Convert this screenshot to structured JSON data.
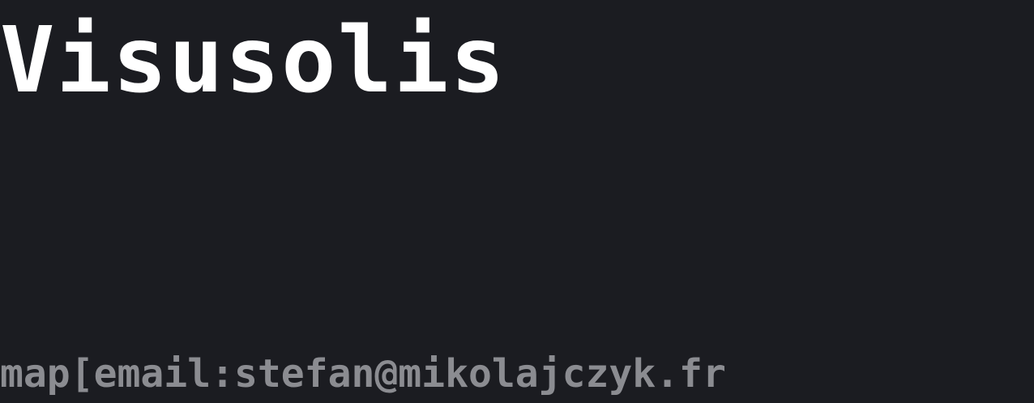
{
  "site": {
    "title": "Visusolis",
    "author_line": "map[email:stefan@mikolajczyk.fr"
  },
  "colors": {
    "background": "#1b1c21",
    "title": "#ffffff",
    "author_line": "#8b8c91"
  }
}
